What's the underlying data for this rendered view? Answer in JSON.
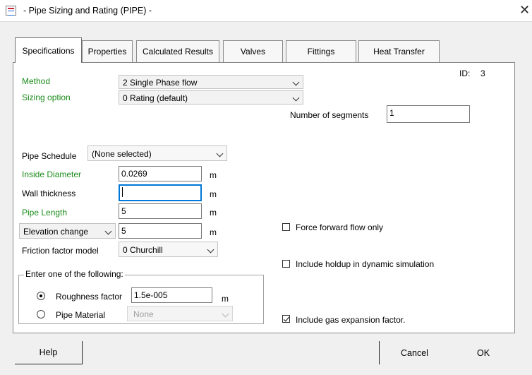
{
  "window": {
    "title": "- Pipe Sizing and Rating (PIPE) -",
    "close_glyph": "✕"
  },
  "tabs": [
    {
      "label": "Specifications",
      "active": true
    },
    {
      "label": "Properties",
      "active": false
    },
    {
      "label": "Calculated Results",
      "active": false
    },
    {
      "label": "Valves",
      "active": false
    },
    {
      "label": "Fittings",
      "active": false
    },
    {
      "label": "Heat Transfer",
      "active": false
    }
  ],
  "spec": {
    "id_label": "ID:",
    "id_value": "3",
    "method": {
      "label": "Method",
      "value": "2 Single Phase flow"
    },
    "sizing_option": {
      "label": "Sizing option",
      "value": "0 Rating (default)"
    },
    "num_segments": {
      "label": "Number of segments",
      "value": "1"
    },
    "pipe_schedule": {
      "label": "Pipe Schedule",
      "value": "(None selected)"
    },
    "inside_diameter": {
      "label": "Inside Diameter",
      "value": "0.0269",
      "unit": "m"
    },
    "wall_thickness": {
      "label": "Wall thickness",
      "value": "",
      "unit": "m"
    },
    "pipe_length": {
      "label": "Pipe Length",
      "value": "5",
      "unit": "m"
    },
    "elevation": {
      "selector": "Elevation change",
      "value": "5",
      "unit": "m"
    },
    "friction_model": {
      "label": "Friction factor model",
      "value": "0 Churchill"
    },
    "group": {
      "title": "Enter one of the following:",
      "roughness": {
        "label": "Roughness factor",
        "value": "1.5e-005",
        "unit": "m",
        "selected": true
      },
      "pipe_material": {
        "label": "Pipe Material",
        "value": "None",
        "selected": false
      }
    },
    "force_forward": {
      "label": "Force forward flow only",
      "checked": false
    },
    "include_holdup": {
      "label": "Include holdup in dynamic simulation",
      "checked": false
    },
    "gas_expansion": {
      "label": "Include gas expansion factor.",
      "checked": true
    }
  },
  "buttons": {
    "help": "Help",
    "cancel": "Cancel",
    "ok": "OK"
  },
  "colors": {
    "field_label_green": "#1a8c1a",
    "focus_blue": "#0078d7"
  }
}
